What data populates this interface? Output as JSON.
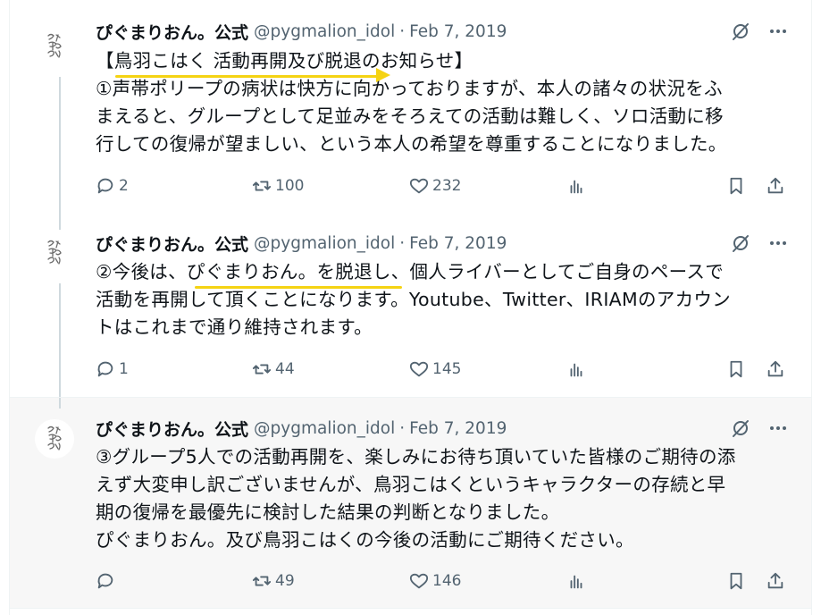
{
  "tweets": [
    {
      "name": "ぴぐまりおん。公式",
      "handle": "@pygmalion_idol",
      "separator": "·",
      "date": "Feb 7, 2019",
      "text_lines": [
        "【鳥羽こはく 活動再開及び脱退のお知らせ】",
        "①声帯ポリープの病状は快方に向かっておりますが、本人の諸々の状況をふ",
        "まえると、グループとして足並みをそろえての活動は難しく、ソロ活動に移",
        "行しての復帰が望ましい、という本人の希望を尊重することになりました。"
      ],
      "replies": "2",
      "reposts": "100",
      "likes": "232",
      "views": ""
    },
    {
      "name": "ぴぐまりおん。公式",
      "handle": "@pygmalion_idol",
      "separator": "·",
      "date": "Feb 7, 2019",
      "text_lines": [
        "②今後は、ぴぐまりおん。を脱退し、個人ライバーとしてご自身のペースで",
        "活動を再開して頂くことになります。Youtube、Twitter、IRIAMのアカウン",
        "トはこれまで通り維持されます。"
      ],
      "replies": "1",
      "reposts": "44",
      "likes": "145",
      "views": ""
    },
    {
      "name": "ぴぐまりおん。公式",
      "handle": "@pygmalion_idol",
      "separator": "·",
      "date": "Feb 7, 2019",
      "text_lines": [
        "③グループ5人での活動再開を、楽しみにお待ち頂いていた皆様のご期待の添",
        "えず大変申し訳ございませんが、鳥羽こはくというキャラクターの存続と早",
        "期の復帰を最優先に検討した結果の判断となりました。",
        "ぴぐまりおん。及び鳥羽こはくの今後の活動にご期待ください。"
      ],
      "replies": "",
      "reposts": "49",
      "likes": "146",
      "views": ""
    }
  ],
  "colors": {
    "text": "#0f1419",
    "muted": "#536471",
    "highlight": "#f5d313",
    "thread_line": "#cfd9de",
    "focused_bg": "#f7f7f7"
  },
  "icons": [
    "avatar-logo",
    "grok-icon",
    "more-icon",
    "reply-icon",
    "repost-icon",
    "like-icon",
    "views-icon",
    "bookmark-icon",
    "share-icon"
  ]
}
